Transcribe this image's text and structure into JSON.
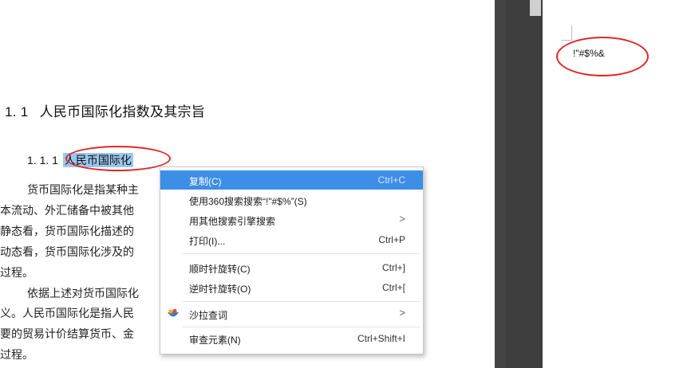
{
  "document": {
    "heading1": {
      "number": "1. 1",
      "text": "人民币国际化指数及其宗旨"
    },
    "heading2": {
      "number": "1. 1. 1",
      "highlighted": "人民币国际化"
    },
    "paragraph_lines": [
      "货币国际化是指某种主",
      "本流动、外汇储备中被其他",
      "静态看，货币国际化描述的",
      "动态看，货币国际化涉及的",
      "过程。",
      "依据上述对货币国际化",
      "义。人民币国际化是指人民",
      "要的贸易计价结算货币、金",
      "过程。"
    ]
  },
  "right_page": {
    "text": "!\"#$%&"
  },
  "context_menu": {
    "items": [
      {
        "label": "复制(C)",
        "shortcut": "Ctrl+C"
      },
      {
        "label": "使用360搜索搜索“!\"#$%”(S)",
        "shortcut": ""
      },
      {
        "label": "用其他搜索引擎搜索",
        "shortcut": ">"
      },
      {
        "label": "打印(I)...",
        "shortcut": "Ctrl+P"
      },
      {
        "label": "顺时针旋转(C)",
        "shortcut": "Ctrl+]"
      },
      {
        "label": "逆时针旋转(O)",
        "shortcut": "Ctrl+["
      },
      {
        "label": "沙拉查词",
        "shortcut": ">"
      },
      {
        "label": "审查元素(N)",
        "shortcut": "Ctrl+Shift+I"
      }
    ]
  },
  "colors": {
    "highlight": "#9ac6ec",
    "menu_active": "#3d8ee6",
    "annotation_red": "#e02525",
    "gutter": "#444444"
  },
  "icons": {
    "salad_dict": "salad-dict-icon"
  }
}
